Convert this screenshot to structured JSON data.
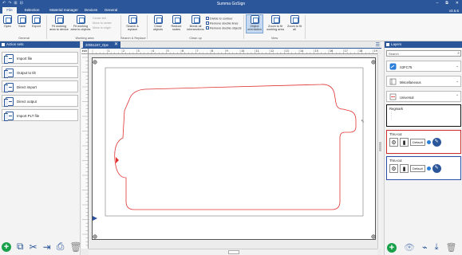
{
  "window": {
    "title": "Summa GoSign",
    "version": "v3.5.6",
    "quick_access": [
      "↶",
      "↷",
      "⊞",
      "⊟"
    ],
    "controls": [
      "–",
      "⧉",
      "✕"
    ]
  },
  "menu": {
    "tabs": [
      "File",
      "Selection",
      "Material manager",
      "Devices",
      "General"
    ],
    "active_index": 0
  },
  "ribbon": {
    "general": {
      "open": "Open",
      "save": "Save",
      "export": "Export",
      "group": "General"
    },
    "working_area": {
      "fit_to_device": "Fit working area to device",
      "fit_to_objects": "Fit working area to objects",
      "center_left": "Center left",
      "move_to_center": "Move to center",
      "move_to_origin": "Move to origin",
      "group": "Working area"
    },
    "search": {
      "label": "Search & replace",
      "group": "Search & Replace"
    },
    "cleanup": {
      "close_objects": "Close objects",
      "reduce_nodes": "Reduce nodes",
      "break_all": "Break all intersections",
      "divide_contour": "Divide to contour",
      "remove_double_lines": "Remove double lines",
      "remove_double_objects": "Remove double objects",
      "group": "Clean up"
    },
    "view": {
      "object_orientation": "Object orientation",
      "zoom_fit_working": "Zoom to fit working area",
      "zoom_fit_all": "Zoom to fit all",
      "group": "View"
    }
  },
  "left_panel": {
    "title": "Action sets",
    "actions": [
      "Import file",
      "Output to tilt",
      "Direct import",
      "Direct output",
      "Import PLT file"
    ],
    "bottom_icons": [
      "add",
      "copy",
      "tools",
      "export",
      "print",
      "delete"
    ]
  },
  "document": {
    "tab_title": "20051247_Ope",
    "ruler_unit": "inch",
    "ruler_ticks": [
      "1",
      "2",
      "3",
      "4",
      "5",
      "6",
      "7",
      "8",
      "9",
      "10",
      "11",
      "12",
      "13",
      "14",
      "15",
      "16",
      "17",
      "18",
      "19"
    ]
  },
  "right_panel": {
    "title": "Layers",
    "search_placeholder": "Search",
    "groups": [
      "S3FC75",
      "Miscellaneous",
      "Universal"
    ],
    "layers": [
      {
        "name": "Regmark",
        "color": "#111111"
      },
      {
        "name": "Thru-cut",
        "color": "#cc2b2b",
        "tool": "Default"
      },
      {
        "name": "Thru-cut",
        "color": "#2b4fa8",
        "tool": "Default"
      }
    ]
  },
  "colors": {
    "brand": "#2b579a",
    "contour": "#e03030",
    "regmark": "#2a4ea0",
    "add_button": "#19a04b"
  }
}
